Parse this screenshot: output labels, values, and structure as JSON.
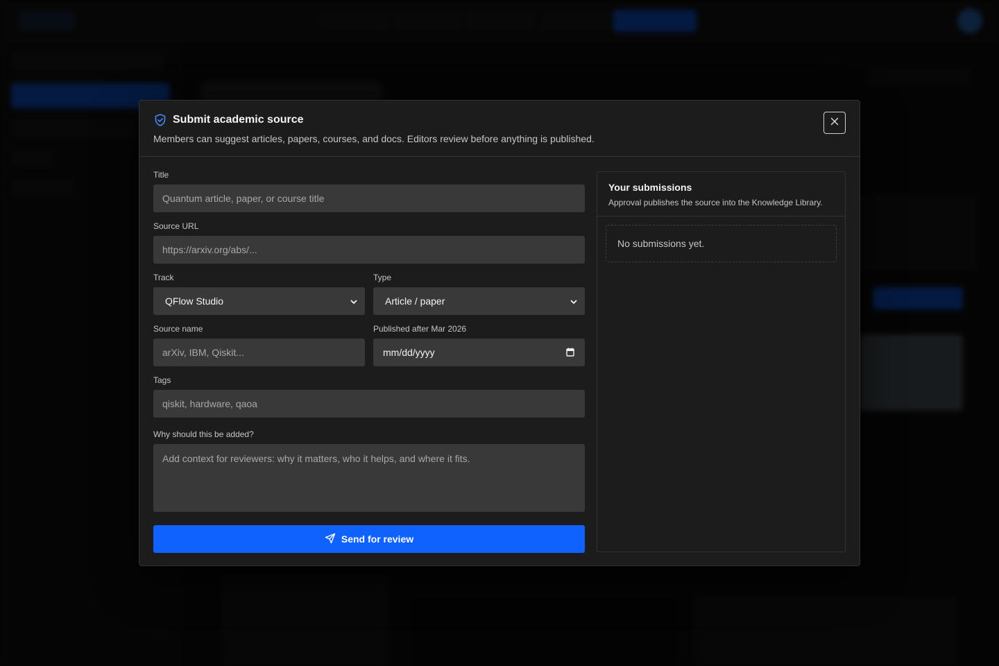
{
  "modal": {
    "title": "Submit academic source",
    "subtitle": "Members can suggest articles, papers, courses, and docs. Editors review before anything is published.",
    "close_icon": "close-icon",
    "header_icon": "shield-check-icon"
  },
  "form": {
    "title": {
      "label": "Title",
      "placeholder": "Quantum article, paper, or course title",
      "value": ""
    },
    "source_url": {
      "label": "Source URL",
      "placeholder": "https://arxiv.org/abs/...",
      "value": ""
    },
    "track": {
      "label": "Track",
      "selected": "QFlow Studio"
    },
    "type": {
      "label": "Type",
      "selected": "Article / paper"
    },
    "source_name": {
      "label": "Source name",
      "placeholder": "arXiv, IBM, Qiskit...",
      "value": ""
    },
    "published": {
      "label": "Published after Mar 2026",
      "value": "mm/dd/yyyy"
    },
    "tags": {
      "label": "Tags",
      "placeholder": "qiskit, hardware, qaoa",
      "value": ""
    },
    "reason": {
      "label": "Why should this be added?",
      "placeholder": "Add context for reviewers: why it matters, who it helps, and where it fits.",
      "value": ""
    },
    "submit_label": "Send for review"
  },
  "submissions": {
    "title": "Your submissions",
    "subtitle": "Approval publishes the source into the Knowledge Library.",
    "empty_text": "No submissions yet."
  },
  "colors": {
    "accent": "#0f62fe",
    "modal_bg": "#1c1c1c",
    "input_bg": "#393939"
  }
}
